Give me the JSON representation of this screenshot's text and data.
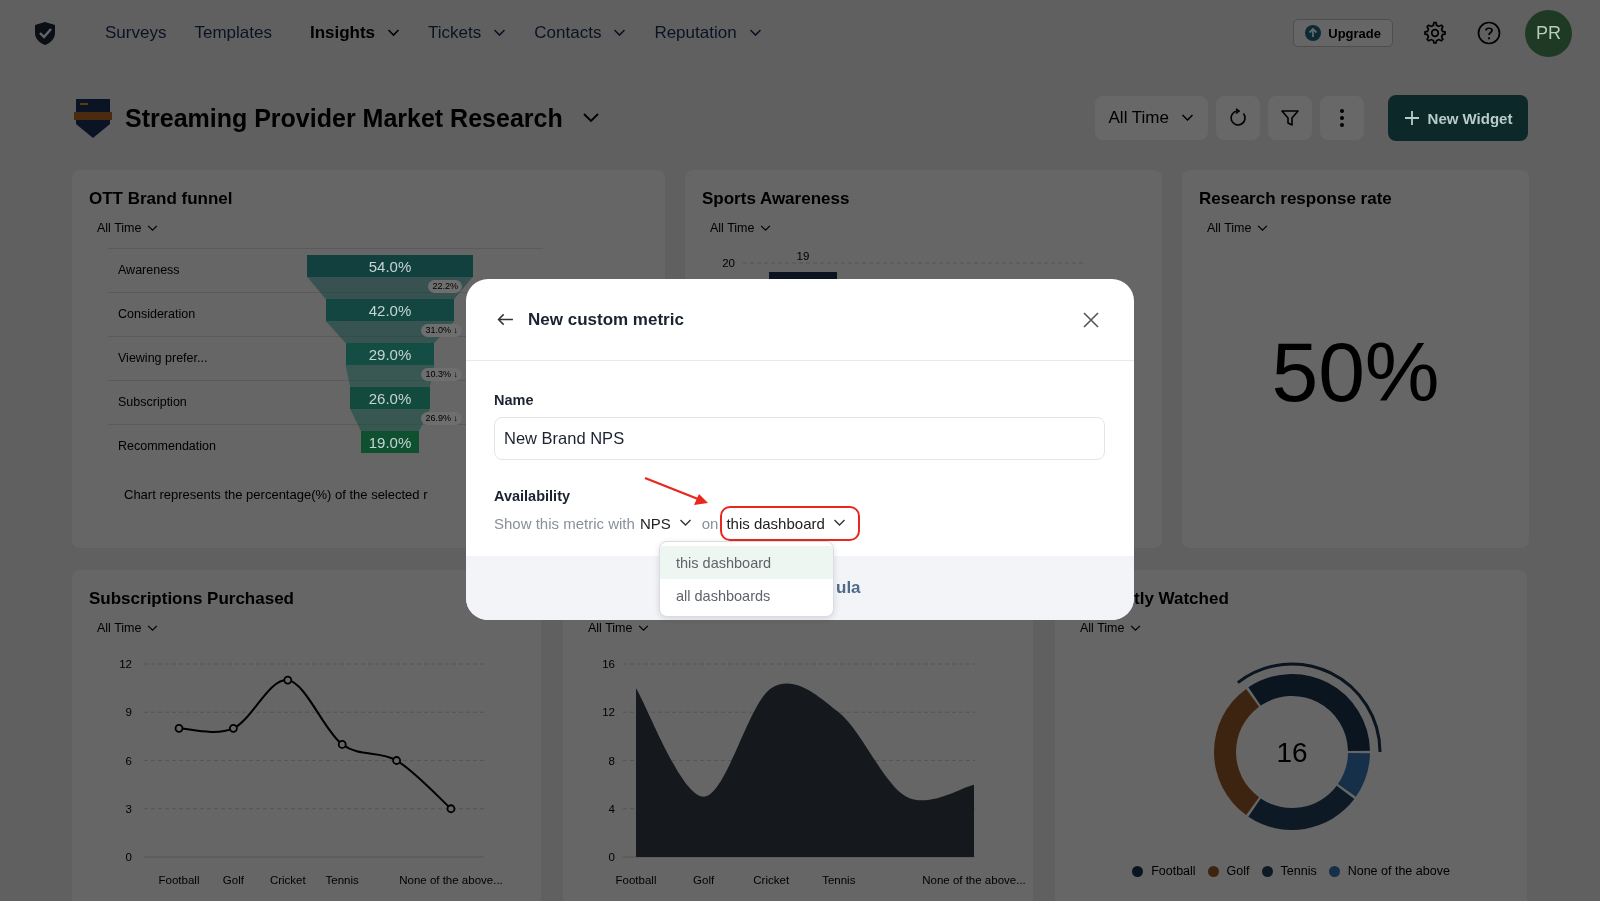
{
  "nav": {
    "items": [
      {
        "label": "Surveys",
        "selected": false,
        "dropdown": false
      },
      {
        "label": "Templates",
        "selected": false,
        "dropdown": false
      },
      {
        "label": "Insights",
        "selected": true,
        "dropdown": true
      },
      {
        "label": "Tickets",
        "selected": false,
        "dropdown": true
      },
      {
        "label": "Contacts",
        "selected": false,
        "dropdown": true
      },
      {
        "label": "Reputation",
        "selected": false,
        "dropdown": true
      }
    ]
  },
  "upgrade_button": "Upgrade",
  "avatar": "PR",
  "dashboard": {
    "title": "Streaming Provider Market Research",
    "period": "All Time",
    "new_widget": "New Widget"
  },
  "widgets": [
    {
      "kind": "funnel",
      "title": "OTT Brand funnel",
      "period": "All Time",
      "stages": [
        {
          "label": "Awareness",
          "value": "54.0%",
          "drop": "22.2%"
        },
        {
          "label": "Consideration",
          "value": "42.0%",
          "drop": "31.0% ↓"
        },
        {
          "label": "Viewing prefer...",
          "value": "29.0%",
          "drop": "10.3% ↓"
        },
        {
          "label": "Subscription",
          "value": "26.0%",
          "drop": "26.9% ↓"
        },
        {
          "label": "Recommendation",
          "value": "19.0%"
        }
      ],
      "note": "Chart represents the percentage(%) of the selected r"
    },
    {
      "kind": "bars",
      "title": "Sports Awareness",
      "period": "All Time",
      "tick": "20",
      "bar_label": "19"
    },
    {
      "kind": "number",
      "title": "Research response rate",
      "period": "All Time",
      "value": "50%"
    },
    {
      "kind": "chart",
      "title": "Subscriptions Purchased",
      "period": "All Time",
      "chart_data": {
        "type": "line",
        "marker": "circle",
        "grid": true,
        "categories": [
          "Football",
          "Golf",
          "Cricket",
          "Tennis",
          null,
          "None of the above..."
        ],
        "values": [
          8,
          8,
          11,
          7,
          6,
          3
        ],
        "ylim": [
          0,
          12
        ],
        "yticks": [
          0,
          3,
          6,
          9,
          12
        ]
      }
    },
    {
      "kind": "chart",
      "period": "All Time",
      "chart_data": {
        "type": "area",
        "grid": true,
        "categories": [
          "Football",
          "Golf",
          "Cricket",
          "Tennis",
          null,
          "None of the above..."
        ],
        "values": [
          14,
          5,
          14,
          12,
          5,
          6
        ],
        "ylim": [
          0,
          16
        ],
        "yticks": [
          0,
          4,
          8,
          12,
          16
        ]
      }
    },
    {
      "kind": "donut",
      "title": "tly Watched",
      "period": "All Time",
      "center": "16",
      "legend": [
        {
          "label": "Football",
          "color": "#0a1520"
        },
        {
          "label": "Golf",
          "color": "#3d2410"
        },
        {
          "label": "Tennis",
          "color": "#0d1a26"
        },
        {
          "label": "None of the above",
          "color": "#16304a"
        }
      ]
    }
  ],
  "modal": {
    "title": "New custom metric",
    "name_label": "Name",
    "name_value": "New Brand NPS",
    "availability_label": "Availability",
    "availability_prefix": "Show this metric with",
    "metric": "NPS",
    "joiner": "on",
    "scope": "this dashboard",
    "footer_text": "ula",
    "menu": [
      {
        "label": "this dashboard",
        "selected": true
      },
      {
        "label": "all dashboards",
        "selected": false
      }
    ]
  }
}
